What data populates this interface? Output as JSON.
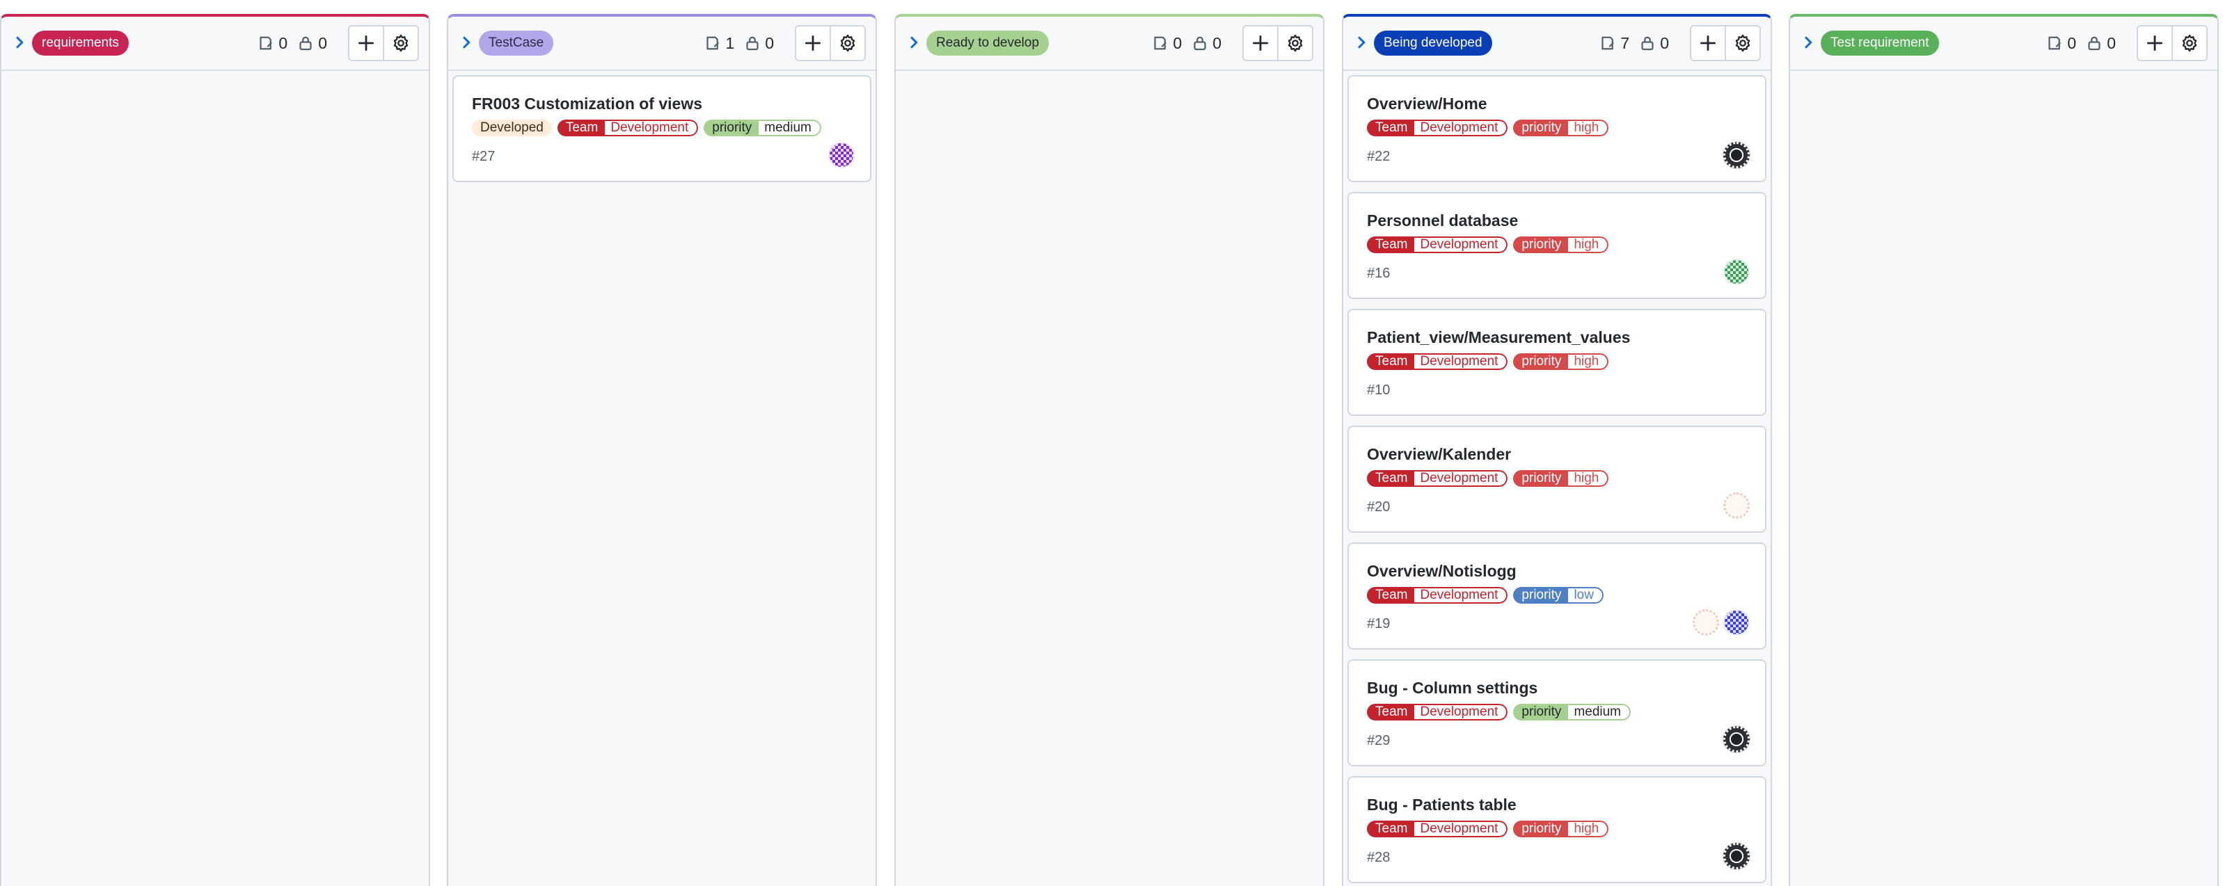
{
  "columns": [
    {
      "label": "requirements",
      "label_bg": "#c72454",
      "label_color": "#ffffff",
      "accent": "#c72454",
      "issues_count": "0",
      "prs_count": "0",
      "cards": []
    },
    {
      "label": "TestCase",
      "label_bg": "#b2a7e8",
      "label_color": "#2d2a4a",
      "accent": "#9a8ce0",
      "issues_count": "1",
      "prs_count": "0",
      "cards": [
        {
          "title": "FR003 Customization of views",
          "status": "Developed",
          "team_key": "Team",
          "team_value": "Development",
          "priority_key": "priority",
          "priority_value": "medium",
          "number": "#27",
          "avatars": [
            "purple-avatar"
          ]
        }
      ]
    },
    {
      "label": "Ready to develop",
      "label_bg": "#a6d08f",
      "label_color": "#24292f",
      "accent": "#a6d08f",
      "issues_count": "0",
      "prs_count": "0",
      "cards": []
    },
    {
      "label": "Being developed",
      "label_bg": "#0b3fb8",
      "label_color": "#ffffff",
      "accent": "#0b3fb8",
      "issues_count": "7",
      "prs_count": "0",
      "cards": [
        {
          "title": "Overview/Home",
          "team_key": "Team",
          "team_value": "Development",
          "priority_key": "priority",
          "priority_value": "high",
          "number": "#22",
          "avatars": [
            "dark-avatar"
          ]
        },
        {
          "title": "Personnel database",
          "team_key": "Team",
          "team_value": "Development",
          "priority_key": "priority",
          "priority_value": "high",
          "number": "#16",
          "avatars": [
            "green-avatar"
          ]
        },
        {
          "title": "Patient_view/Measurement_values",
          "team_key": "Team",
          "team_value": "Development",
          "priority_key": "priority",
          "priority_value": "high",
          "number": "#10",
          "avatars": []
        },
        {
          "title": "Overview/Kalender",
          "team_key": "Team",
          "team_value": "Development",
          "priority_key": "priority",
          "priority_value": "high",
          "number": "#20",
          "avatars": [
            "pale-avatar"
          ]
        },
        {
          "title": "Overview/Notislogg",
          "team_key": "Team",
          "team_value": "Development",
          "priority_key": "priority",
          "priority_value": "low",
          "number": "#19",
          "avatars": [
            "pale-avatar",
            "blue-avatar"
          ]
        },
        {
          "title": "Bug - Column settings",
          "team_key": "Team",
          "team_value": "Development",
          "priority_key": "priority",
          "priority_value": "medium",
          "number": "#29",
          "avatars": [
            "dark-avatar"
          ]
        },
        {
          "title": "Bug - Patients table",
          "team_key": "Team",
          "team_value": "Development",
          "priority_key": "priority",
          "priority_value": "high",
          "number": "#28",
          "avatars": [
            "dark-avatar"
          ]
        }
      ]
    },
    {
      "label": "Test requirement",
      "label_bg": "#58b05a",
      "label_color": "#ffffff",
      "accent": "#6bb86a",
      "issues_count": "0",
      "prs_count": "0",
      "cards": []
    }
  ],
  "icons": {
    "collapse": "chevron-right-icon",
    "issues": "issue-note-icon",
    "pull_requests": "person-lock-icon",
    "add": "plus-icon",
    "settings": "gear-icon"
  }
}
